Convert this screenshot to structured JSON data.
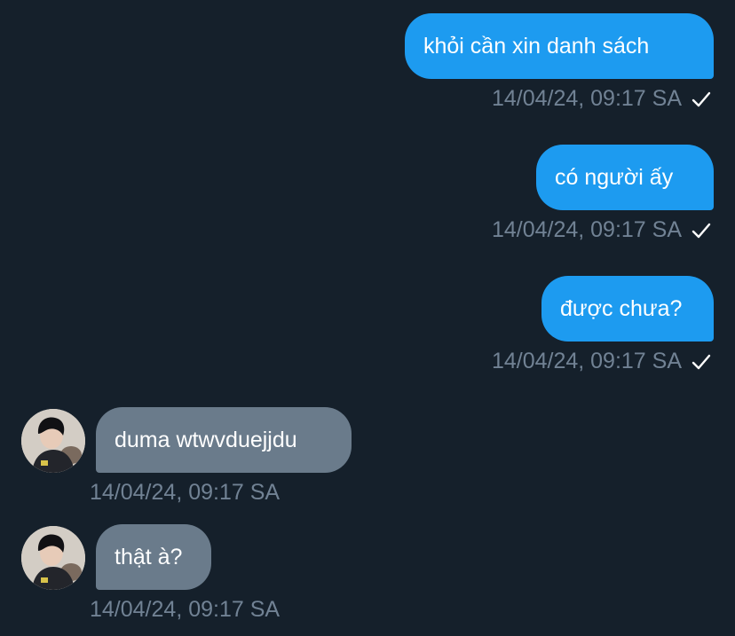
{
  "messages": [
    {
      "text": "khỏi cần xin danh sách",
      "time": "14/04/24, 09:17 SA",
      "direction": "outgoing",
      "status_icon": "check-icon"
    },
    {
      "text": "có người ấy",
      "time": "14/04/24, 09:17 SA",
      "direction": "outgoing",
      "status_icon": "check-icon"
    },
    {
      "text": "được chưa?",
      "time": "14/04/24, 09:17 SA",
      "direction": "outgoing",
      "status_icon": "check-icon"
    },
    {
      "text": "duma wtwvduejjdu",
      "time": "14/04/24, 09:17 SA",
      "direction": "incoming",
      "avatar_icon": "user-avatar"
    },
    {
      "text": "thật à?",
      "time": "14/04/24, 09:17 SA",
      "direction": "incoming",
      "avatar_icon": "user-avatar"
    }
  ],
  "colors": {
    "background": "#15202b",
    "outgoing_bubble": "#1d9bf0",
    "incoming_bubble": "#6a7b8b",
    "timestamp": "#718294",
    "text": "#ffffff"
  }
}
